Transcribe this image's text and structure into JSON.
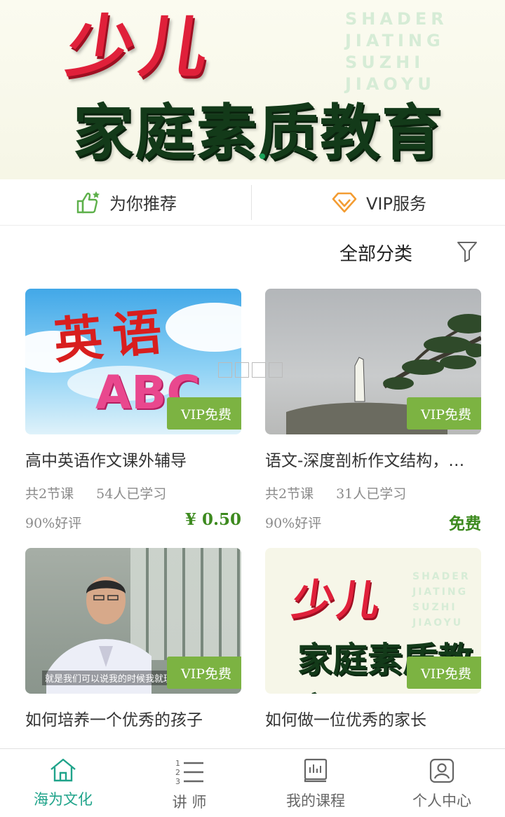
{
  "banner": {
    "headline_top": "少儿",
    "headline_main": "家庭素质教育",
    "pinyin": [
      "SHADER",
      "JIATING",
      "SUZHI",
      "JIAOYU"
    ]
  },
  "tabs": {
    "recommend_label": "为你推荐",
    "vip_label": "VIP服务"
  },
  "filter": {
    "all_categories_label": "全部分类"
  },
  "courses": [
    {
      "title": "高中英语作文课外辅导",
      "lessons": "共2节课",
      "learners": "54人已学习",
      "rating": "90%好评",
      "price": "¥ 0.50",
      "badge": "VIP免费",
      "thumb_text": "英语",
      "thumb_letters": "ABC"
    },
    {
      "title": "语文-深度剖析作文结构，…",
      "lessons": "共2节课",
      "learners": "31人已学习",
      "rating": "90%好评",
      "price": "免费",
      "badge": "VIP免费"
    },
    {
      "title": "如何培养一个优秀的孩子",
      "badge": "VIP免费",
      "thumb_caption": "就是我们可以说我的时候我就理解"
    },
    {
      "title": "如何做一位优秀的家长",
      "badge": "VIP免费",
      "thumb_top": "少儿",
      "thumb_main": "家庭素质教育",
      "thumb_pinyin": [
        "SHADER",
        "JIATING",
        "SUZHI",
        "JIAOYU"
      ]
    }
  ],
  "bottom_nav": [
    {
      "label": "海为文化",
      "icon": "home-icon",
      "active": true
    },
    {
      "label": "讲 师",
      "icon": "list-icon",
      "active": false
    },
    {
      "label": "我的课程",
      "icon": "book-icon",
      "active": false
    },
    {
      "label": "个人中心",
      "icon": "user-icon",
      "active": false
    }
  ],
  "colors": {
    "accent_teal": "#1fa38a",
    "vip_green": "#7cb342",
    "price_green": "#3d8a1f",
    "vip_orange": "#f39c32"
  }
}
